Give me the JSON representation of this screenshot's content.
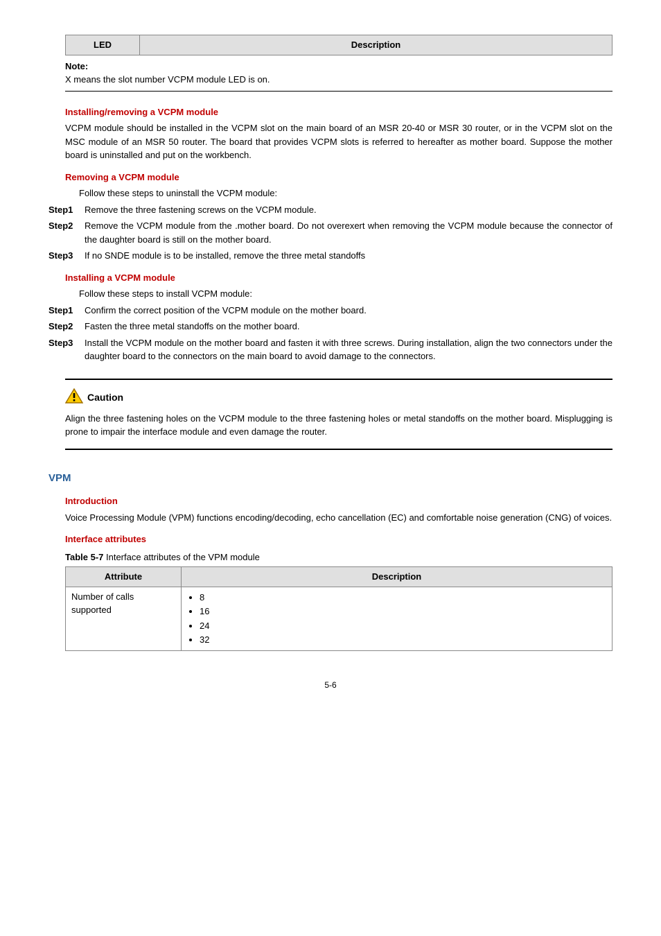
{
  "table1": {
    "headers": {
      "led": "LED",
      "desc": "Description"
    },
    "note_label": "Note:",
    "note_text": "X means the slot number VCPM module LED is on."
  },
  "sec_install_remove": {
    "heading": "Installing/removing a VCPM module",
    "para": "VCPM module should be installed in the VCPM slot on the main board of an MSR 20-40 or MSR 30 router, or in the VCPM slot on the MSC module of an MSR 50 router. The board that provides VCPM slots is referred to hereafter as mother board. Suppose the mother board is uninstalled and put on the workbench."
  },
  "sec_remove": {
    "heading": "Removing a VCPM module",
    "intro": "Follow these steps to uninstall the VCPM module:",
    "steps": {
      "s1": {
        "label": "Step1",
        "text": "Remove the three fastening screws on the VCPM module."
      },
      "s2": {
        "label": "Step2",
        "text": "Remove the VCPM module from the .mother board. Do not overexert when removing the VCPM module because the connector of the daughter board is still on the mother board."
      },
      "s3": {
        "label": "Step3",
        "text": "If no SNDE module is to be installed, remove the three metal standoffs"
      }
    }
  },
  "sec_install": {
    "heading": "Installing a VCPM module",
    "intro": "Follow these steps to install VCPM module:",
    "steps": {
      "s1": {
        "label": "Step1",
        "text": "Confirm the correct position of the VCPM module on the mother board."
      },
      "s2": {
        "label": "Step2",
        "text": "Fasten the three metal standoffs on the mother board."
      },
      "s3": {
        "label": "Step3",
        "text": "Install the VCPM module on the mother board and fasten it with three screws. During installation, align the two connectors under the daughter board to the connectors on the main board to avoid damage to the connectors."
      }
    }
  },
  "caution": {
    "label": "Caution",
    "text": "Align the three fastening holes on the VCPM module to the three fastening holes or metal standoffs on the mother board. Misplugging is prone to impair the interface module and even damage the router."
  },
  "vpm": {
    "heading": "VPM",
    "intro_heading": "Introduction",
    "intro_text": "Voice Processing Module (VPM) functions encoding/decoding, echo cancellation (EC) and comfortable noise generation (CNG) of voices.",
    "attr_heading": "Interface attributes",
    "table_caption_num": "Table 5-7",
    "table_caption_text": " Interface attributes of the VPM module",
    "table": {
      "headers": {
        "attr": "Attribute",
        "desc": "Description"
      },
      "row1": {
        "attr": "Number of calls supported",
        "vals": {
          "v1": "8",
          "v2": "16",
          "v3": "24",
          "v4": "32"
        }
      }
    }
  },
  "footer": "5-6"
}
